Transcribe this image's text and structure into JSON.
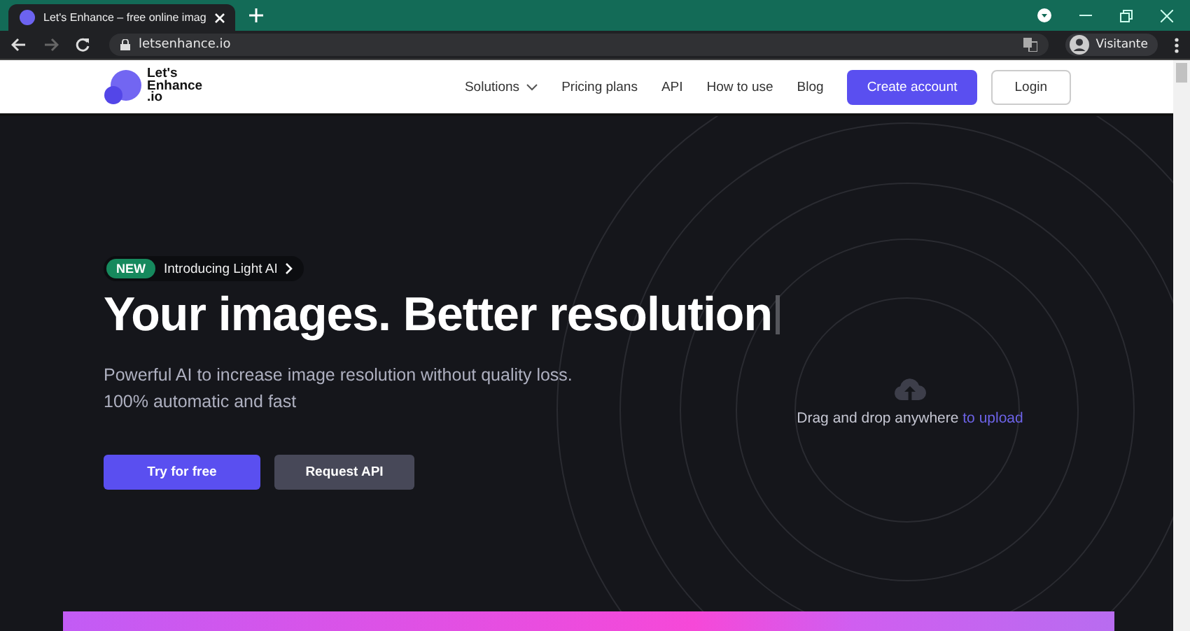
{
  "browser": {
    "tab_title": "Let's Enhance – free online imag",
    "url": "letsenhance.io",
    "profile": "Visitante"
  },
  "nav": {
    "logo": [
      "Let's",
      "Enhance",
      ".io"
    ],
    "links": [
      {
        "label": "Solutions",
        "kind": "dropdown"
      },
      {
        "label": "Pricing plans",
        "kind": "link"
      },
      {
        "label": "API",
        "kind": "link"
      },
      {
        "label": "How to use",
        "kind": "link"
      },
      {
        "label": "Blog",
        "kind": "link"
      }
    ],
    "primary_button": "Create account",
    "secondary_button": "Login"
  },
  "hero": {
    "badge": "NEW",
    "announcement": "Introducing Light AI",
    "title": "Your images. Better resolution",
    "subtitle": [
      "Powerful AI to increase image resolution without quality loss.",
      "100% automatic and fast"
    ],
    "primary_button": "Try for free",
    "secondary_button": "Request API"
  },
  "upload": {
    "text": "Drag and drop anywhere",
    "link": "to upload"
  }
}
